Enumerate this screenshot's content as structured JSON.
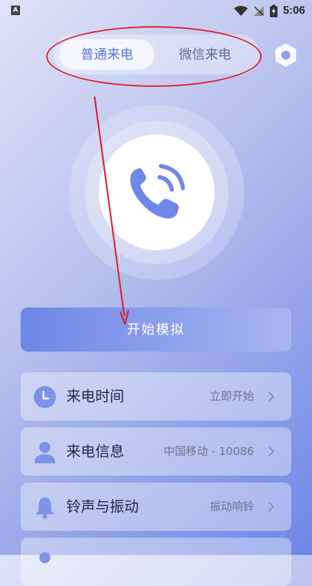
{
  "status_bar": {
    "time": "5:06",
    "left_icon_letter": "A"
  },
  "tabs": [
    {
      "label": "普通来电",
      "active": true
    },
    {
      "label": "微信来电",
      "active": false
    }
  ],
  "start_button": {
    "label": "开始模拟"
  },
  "settings": [
    {
      "label": "来电时间",
      "value": "立即开始",
      "icon": "clock-icon"
    },
    {
      "label": "来电信息",
      "value": "中国移动 - 10086",
      "icon": "person-icon"
    },
    {
      "label": "铃声与振动",
      "value": "振动响铃",
      "icon": "bell-icon"
    },
    {
      "label": "",
      "value": "",
      "icon": "person-icon"
    }
  ],
  "colors": {
    "accent": "#6f87e6",
    "active_tab_text": "#5a72d6",
    "annotation": "#e01b2a"
  }
}
